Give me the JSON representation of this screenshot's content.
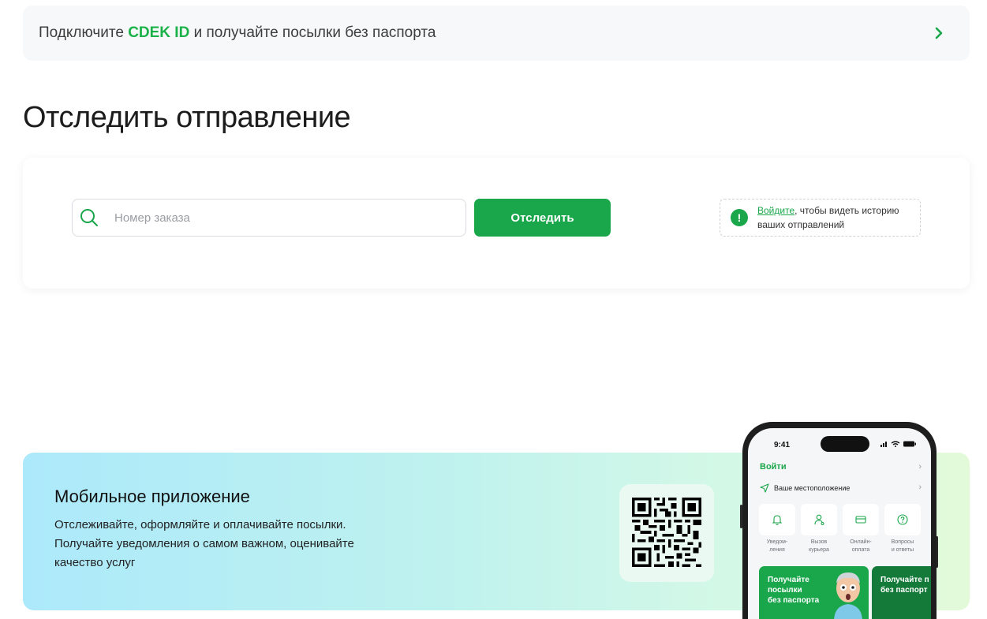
{
  "promo": {
    "prefix": "Подключите ",
    "brand": "CDEK ID",
    "suffix": " и получайте посылки без паспорта"
  },
  "page_title": "Отследить отправление",
  "tracking": {
    "placeholder": "Номер заказа",
    "button_label": "Отследить",
    "hint_link": "Войдите",
    "hint_text_1": ", чтобы видеть историю",
    "hint_text_2": "ваших отправлений"
  },
  "app_banner": {
    "title": "Мобильное приложение",
    "description": "Отслеживайте, оформляйте и оплачивайте посылки. Получайте уведомления о самом важном, оценивайте качество услуг"
  },
  "phone": {
    "time": "9:41",
    "login": "Войти",
    "location": "Ваше местоположение",
    "tiles": [
      {
        "icon": "bell-icon",
        "label": "Уведом-\nления"
      },
      {
        "icon": "courier-icon",
        "label": "Вызов\nкурьера"
      },
      {
        "icon": "card-icon",
        "label": "Онлайн-\nоплата"
      },
      {
        "icon": "question-icon",
        "label": "Вопросы\nи ответы"
      }
    ],
    "promo_card_1": "Получайте\nпосылки\nбез паспорта",
    "promo_card_2": "Получайте п\nбез паспорт"
  },
  "colors": {
    "brand_green": "#1aa64a",
    "brand_text_green": "#1ab248"
  }
}
